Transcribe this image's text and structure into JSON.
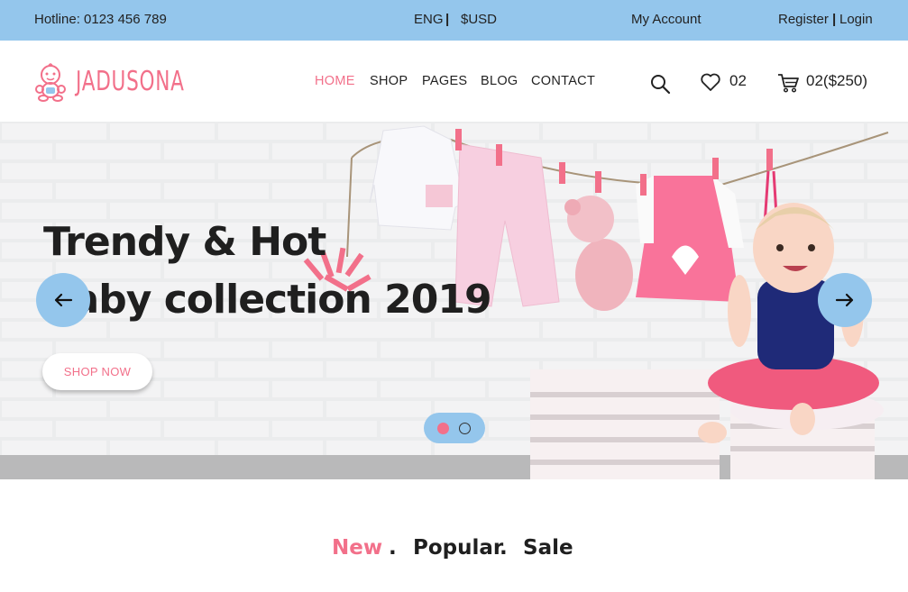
{
  "topbar": {
    "hotline": "Hotline: 0123 456 789",
    "language": "ENG",
    "separator": "|",
    "currency": "$USD",
    "account": "My Account",
    "register": "Register",
    "login": "Login"
  },
  "header": {
    "logo_text": "JADUSONA",
    "nav": [
      {
        "label": "HOME",
        "active": true
      },
      {
        "label": "SHOP"
      },
      {
        "label": "PAGES"
      },
      {
        "label": "BLOG"
      },
      {
        "label": "CONTACT"
      }
    ],
    "wishlist_count": "02",
    "cart_summary": "02($250)",
    "icons": [
      "search-icon",
      "heart-icon",
      "cart-icon"
    ]
  },
  "hero": {
    "title_line1": "Trendy & Hot",
    "title_line2": "Baby collection 2019",
    "button": "SHOP NOW",
    "slides": 2,
    "active_slide": 1
  },
  "product_tabs": {
    "items": [
      "New",
      "Popular",
      "Sale"
    ],
    "separator": ".",
    "active": "New"
  },
  "colors": {
    "accent": "#f2708a",
    "topbar": "#94c6ec",
    "text": "#222222"
  }
}
